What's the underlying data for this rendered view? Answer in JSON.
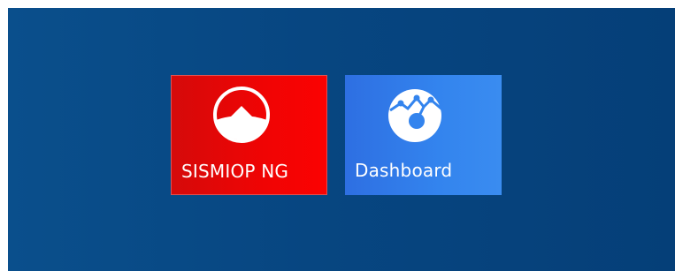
{
  "tiles": [
    {
      "label": "SISMIOP NG",
      "icon": "house-icon",
      "color": "#f20404"
    },
    {
      "label": "Dashboard",
      "icon": "chart-icon",
      "color": "#3384ee"
    }
  ],
  "background_color": "#074681"
}
